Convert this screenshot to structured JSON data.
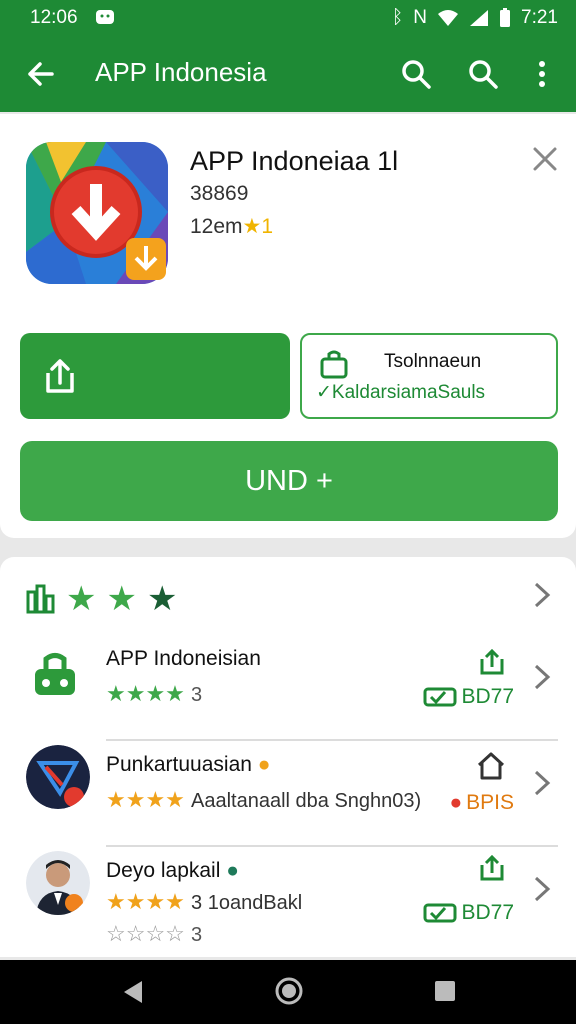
{
  "status": {
    "time": "12:06",
    "right_time": "7:21"
  },
  "appbar": {
    "title": "APP Indonesia"
  },
  "app": {
    "name": "APP Indoneiaa 1l",
    "number": "38869",
    "meta": "12em",
    "meta_star": "★1",
    "share_label": "",
    "secondary_line1": "Tsolnnaeun",
    "secondary_line2": "KaldarsiamaSauls",
    "install_label": "UND +"
  },
  "rating": {
    "stars_filled": 3
  },
  "rows": [
    {
      "title": "APP Indoneisian",
      "stars": "★★★★",
      "count": "3",
      "badge": "BD77"
    },
    {
      "title": "Punkartuuasian",
      "stars": "★★★★",
      "subtitle": "Aaaltanaall dba Snghn03)",
      "badge": "BPIS"
    },
    {
      "title": "Deyo lapkail",
      "stars": "★★★★",
      "subtitle": "3 1oandBakl",
      "stars2": "☆☆☆☆",
      "count2": "3",
      "badge": "BD77"
    }
  ],
  "colors": {
    "primary": "#1e8a35",
    "button": "#3ea84a",
    "star_green": "#3ea84a",
    "star_orange": "#f0a21b"
  }
}
